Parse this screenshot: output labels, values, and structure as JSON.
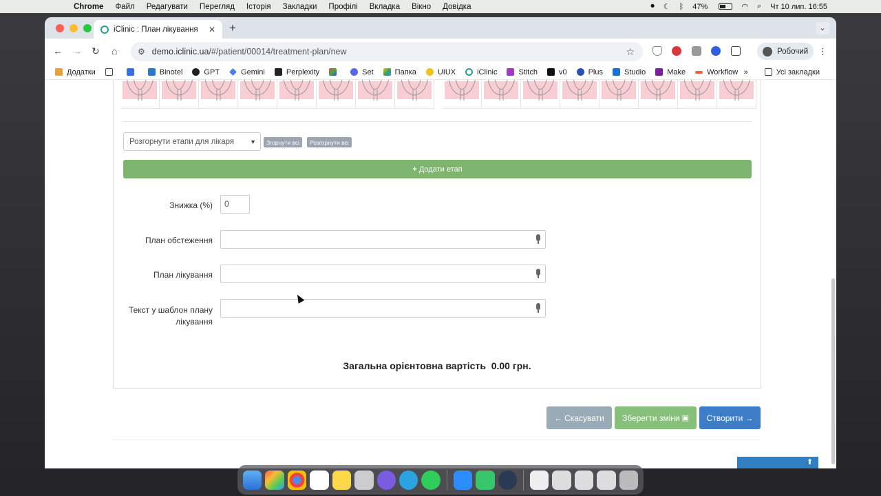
{
  "menubar": {
    "items": [
      "Chrome",
      "Файл",
      "Редагувати",
      "Перегляд",
      "Історія",
      "Закладки",
      "Профілі",
      "Вкладка",
      "Вікно",
      "Довідка"
    ],
    "battery": "47%",
    "datetime": "Чт 10 лип.  16:55"
  },
  "browser": {
    "tab_title": "iClinic : План лікування",
    "url_host": "demo.iclinic.ua",
    "url_path": "/#/patient/00014/treatment-plan/new",
    "profile_name": "Робочий",
    "bookmarks": [
      "Додатки",
      "Binotel",
      "GPT",
      "Gemini",
      "Perplexity",
      "Set",
      "Папка",
      "UIUX",
      "iClinic",
      "Stitch",
      "v0",
      "Plus",
      "Studio",
      "Make",
      "Workflow"
    ],
    "all_bookmarks": "Усі закладки"
  },
  "page": {
    "stage_select_value": "Розгорнути етапи для лікаря",
    "collapse_all": "Згорнути всі",
    "expand_all": "Розгорнути всі",
    "add_stage": "Додати етап",
    "discount_label": "Знижка (%)",
    "discount_value": "0",
    "exam_plan_label": "План обстеження",
    "treatment_plan_label": "План лікування",
    "template_text_label_line1": "Текст у шаблон плану",
    "template_text_label_line2": "лікування",
    "total_label": "Загальна орієнтовна вартість",
    "total_value": "0.00 грн.",
    "cancel_button": "Скасувати",
    "save_button": "Зберегти зміни",
    "create_button": "Створити"
  },
  "colors": {
    "add_stage_bg": "#7db56e",
    "cancel_bg": "#9aabb8",
    "save_bg": "#86c07a",
    "create_bg": "#3d7dc7",
    "tooth_highlight": "#f8cdd4"
  }
}
